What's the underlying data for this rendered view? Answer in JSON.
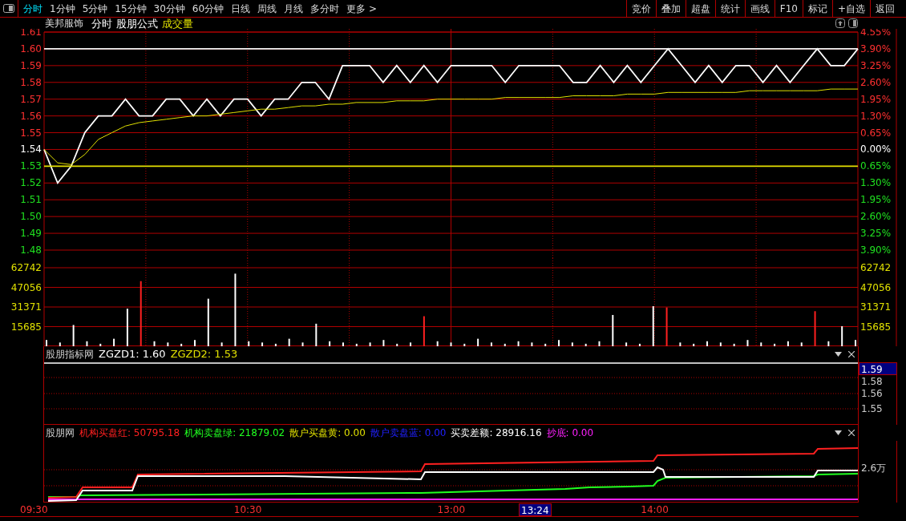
{
  "toolbar": {
    "tabs": [
      {
        "label": "分时",
        "selected": true
      },
      {
        "label": "1分钟",
        "selected": false
      },
      {
        "label": "5分钟",
        "selected": false
      },
      {
        "label": "15分钟",
        "selected": false
      },
      {
        "label": "30分钟",
        "selected": false
      },
      {
        "label": "60分钟",
        "selected": false
      },
      {
        "label": "日线",
        "selected": false
      },
      {
        "label": "周线",
        "selected": false
      },
      {
        "label": "月线",
        "selected": false
      },
      {
        "label": "多分时",
        "selected": false
      },
      {
        "label": "更多 >",
        "selected": false
      }
    ],
    "buttons": [
      "竞价",
      "叠加",
      "超盘",
      "统计",
      "画线",
      "F10",
      "标记",
      "+自选",
      "返回"
    ]
  },
  "chart_header": {
    "stock": "美邦服饰",
    "items": [
      {
        "text": "分时",
        "color": "#ffffff"
      },
      {
        "text": "股朋公式",
        "color": "#ffffff"
      },
      {
        "text": "成交量",
        "color": "#e0e000"
      }
    ]
  },
  "price_panel": {
    "percent_labels": [
      "4.55%",
      "3.90%",
      "3.25%",
      "2.60%",
      "1.95%",
      "1.30%",
      "0.65%",
      "0.00%",
      "0.65%",
      "1.30%",
      "1.95%",
      "2.60%",
      "3.25%",
      "3.90%"
    ],
    "chart_data": {
      "type": "line",
      "ylim": [
        1.48,
        1.61
      ],
      "grid": true,
      "yticks": [
        {
          "value": 1.61,
          "label": "1.61"
        },
        {
          "value": 1.6,
          "label": "1.60"
        },
        {
          "value": 1.59,
          "label": "1.59"
        },
        {
          "value": 1.58,
          "label": "1.58"
        },
        {
          "value": 1.57,
          "label": "1.57"
        },
        {
          "value": 1.56,
          "label": "1.56"
        },
        {
          "value": 1.55,
          "label": "1.55"
        },
        {
          "value": 1.54,
          "label": "1.54"
        },
        {
          "value": 1.53,
          "label": "1.53"
        },
        {
          "value": 1.52,
          "label": "1.52"
        },
        {
          "value": 1.51,
          "label": "1.51"
        },
        {
          "value": 1.5,
          "label": "1.50"
        },
        {
          "value": 1.49,
          "label": "1.49"
        },
        {
          "value": 1.48,
          "label": "1.48"
        }
      ],
      "categories": [
        null,
        null,
        null,
        null,
        null,
        null,
        null,
        null,
        null,
        null,
        null,
        null,
        null,
        null,
        null,
        null,
        null,
        null,
        null,
        null,
        null,
        null,
        null,
        null,
        null,
        null,
        null,
        null,
        null,
        null,
        null,
        null,
        null,
        null,
        null,
        null,
        null,
        null,
        null,
        null,
        null,
        null,
        null,
        null,
        null,
        null,
        null,
        null,
        null,
        null,
        null,
        null,
        null,
        null,
        null,
        null,
        null,
        null,
        null,
        null,
        null
      ],
      "series": [
        {
          "color": "#ffffff",
          "values": [
            1.54,
            1.52,
            1.53,
            1.55,
            1.56,
            1.56,
            1.57,
            1.56,
            1.56,
            1.57,
            1.57,
            1.56,
            1.57,
            1.56,
            1.57,
            1.57,
            1.56,
            1.57,
            1.57,
            1.58,
            1.58,
            1.57,
            1.59,
            1.59,
            1.59,
            1.58,
            1.59,
            1.58,
            1.59,
            1.58,
            1.59,
            1.59,
            1.59,
            1.59,
            1.58,
            1.59,
            1.59,
            1.59,
            1.59,
            1.58,
            1.58,
            1.59,
            1.58,
            1.59,
            1.58,
            1.59,
            1.6,
            1.59,
            1.58,
            1.59,
            1.58,
            1.59,
            1.59,
            1.58,
            1.59,
            1.58,
            1.59,
            1.6,
            1.59,
            1.59,
            1.6
          ]
        },
        {
          "color": "#e0e000",
          "values": [
            1.54,
            1.532,
            1.531,
            1.537,
            1.546,
            1.55,
            1.554,
            1.556,
            1.557,
            1.558,
            1.559,
            1.56,
            1.56,
            1.561,
            1.562,
            1.563,
            1.564,
            1.564,
            1.565,
            1.566,
            1.566,
            1.567,
            1.567,
            1.568,
            1.568,
            1.568,
            1.569,
            1.569,
            1.569,
            1.57,
            1.57,
            1.57,
            1.57,
            1.57,
            1.571,
            1.571,
            1.571,
            1.571,
            1.571,
            1.572,
            1.572,
            1.572,
            1.572,
            1.573,
            1.573,
            1.573,
            1.574,
            1.574,
            1.574,
            1.574,
            1.574,
            1.574,
            1.575,
            1.575,
            1.575,
            1.575,
            1.575,
            1.575,
            1.576,
            1.576,
            1.576
          ]
        },
        {
          "color": "#f4f4f4",
          "values": [
            1.6,
            1.6,
            1.6,
            1.6,
            1.6,
            1.6,
            1.6,
            1.6,
            1.6,
            1.6,
            1.6,
            1.6,
            1.6,
            1.6,
            1.6,
            1.6,
            1.6,
            1.6,
            1.6,
            1.6,
            1.6,
            1.6,
            1.6,
            1.6,
            1.6,
            1.6,
            1.6,
            1.6,
            1.6,
            1.6,
            1.6,
            1.6,
            1.6,
            1.6,
            1.6,
            1.6,
            1.6,
            1.6,
            1.6,
            1.6,
            1.6,
            1.6,
            1.6,
            1.6,
            1.6,
            1.6,
            1.6,
            1.6,
            1.6,
            1.6,
            1.6,
            1.6,
            1.6,
            1.6,
            1.6,
            1.6,
            1.6,
            1.6,
            1.6,
            1.6,
            1.6
          ]
        },
        {
          "color": "#e0e001",
          "values": [
            1.53,
            1.53,
            1.53,
            1.53,
            1.53,
            1.53,
            1.53,
            1.53,
            1.53,
            1.53,
            1.53,
            1.53,
            1.53,
            1.53,
            1.53,
            1.53,
            1.53,
            1.53,
            1.53,
            1.53,
            1.53,
            1.53,
            1.53,
            1.53,
            1.53,
            1.53,
            1.53,
            1.53,
            1.53,
            1.53,
            1.53,
            1.53,
            1.53,
            1.53,
            1.53,
            1.53,
            1.53,
            1.53,
            1.53,
            1.53,
            1.53,
            1.53,
            1.53,
            1.53,
            1.53,
            1.53,
            1.53,
            1.53,
            1.53,
            1.53,
            1.53,
            1.53,
            1.53,
            1.53,
            1.53,
            1.53,
            1.53,
            1.53,
            1.53,
            1.53,
            1.53
          ]
        }
      ]
    }
  },
  "volume_panel": {
    "chart_data": {
      "type": "bar",
      "ylim": [
        0,
        62742
      ],
      "grid": true,
      "yticks": [
        {
          "value": 15685,
          "label": "15685"
        },
        {
          "value": 31371,
          "label": "31371"
        },
        {
          "value": 47056,
          "label": "47056"
        },
        {
          "value": 62742,
          "label": "62742"
        }
      ],
      "categories": [
        null,
        null,
        null,
        null,
        null,
        null,
        null,
        null,
        null,
        null,
        null,
        null,
        null,
        null,
        null,
        null,
        null,
        null,
        null,
        null,
        null,
        null,
        null,
        null,
        null,
        null,
        null,
        null,
        null,
        null,
        null,
        null,
        null,
        null,
        null,
        null,
        null,
        null,
        null,
        null,
        null,
        null,
        null,
        null,
        null,
        null,
        null,
        null,
        null,
        null,
        null,
        null,
        null,
        null,
        null,
        null,
        null,
        null,
        null,
        null,
        null
      ],
      "series": [
        {
          "color": "#ffffff",
          "values": [
            5000,
            3000,
            17000,
            4000,
            2000,
            6000,
            30000,
            null,
            4000,
            3000,
            2000,
            5000,
            38000,
            3000,
            58000,
            4000,
            3000,
            2000,
            6000,
            3000,
            18000,
            4000,
            3000,
            2000,
            3000,
            5000,
            2000,
            3000,
            null,
            4000,
            3000,
            2000,
            6000,
            3000,
            2000,
            4000,
            3000,
            2000,
            5000,
            3000,
            2000,
            4000,
            25000,
            3000,
            2000,
            32000,
            null,
            3000,
            2000,
            4000,
            3000,
            2000,
            5000,
            3000,
            2000,
            4000,
            3000,
            null,
            4000,
            16000,
            5000
          ]
        },
        {
          "color": "#ff2020",
          "values": [
            null,
            null,
            null,
            null,
            null,
            null,
            null,
            52000,
            null,
            null,
            null,
            null,
            null,
            null,
            null,
            null,
            null,
            null,
            null,
            null,
            null,
            null,
            null,
            null,
            null,
            null,
            null,
            null,
            24000,
            null,
            null,
            null,
            null,
            null,
            null,
            null,
            null,
            null,
            null,
            null,
            null,
            null,
            null,
            null,
            null,
            null,
            31000,
            null,
            null,
            null,
            null,
            null,
            null,
            null,
            null,
            null,
            null,
            28000,
            null,
            null,
            null
          ]
        }
      ]
    }
  },
  "indicator_1": {
    "title": "股朋指标网",
    "entries": [
      {
        "text": "ZGZD1: 1.60",
        "color": "#ffffff"
      },
      {
        "text": "ZGZD2: 1.53",
        "color": "#e0e000"
      }
    ],
    "axis_labels": [
      {
        "text": "1.59",
        "selected": true
      },
      {
        "text": "1.58",
        "selected": false
      },
      {
        "text": "1.56",
        "selected": false
      },
      {
        "text": "1.55",
        "selected": false
      }
    ]
  },
  "indicator_2": {
    "title": "股朋网",
    "entries": [
      {
        "text": "机构买盘红: 50795.18",
        "color": "#ff2020"
      },
      {
        "text": "机构卖盘绿: 21879.02",
        "color": "#20ff20"
      },
      {
        "text": "散户买盘黄: 0.00",
        "color": "#e0e000"
      },
      {
        "text": "散户卖盘蓝: 0.00",
        "color": "#2020ff"
      },
      {
        "text": "买卖差额: 28916.16",
        "color": "#ffffff"
      },
      {
        "text": "抄底: 0.00",
        "color": "#ff20ff"
      }
    ],
    "axis_label": "2.6万"
  },
  "time_axis": [
    {
      "label": "09:30",
      "selected": false
    },
    {
      "label": "10:30",
      "selected": false
    },
    {
      "label": "13:00",
      "selected": false
    },
    {
      "label": "13:24",
      "selected": true
    },
    {
      "label": "14:00",
      "selected": false
    }
  ]
}
